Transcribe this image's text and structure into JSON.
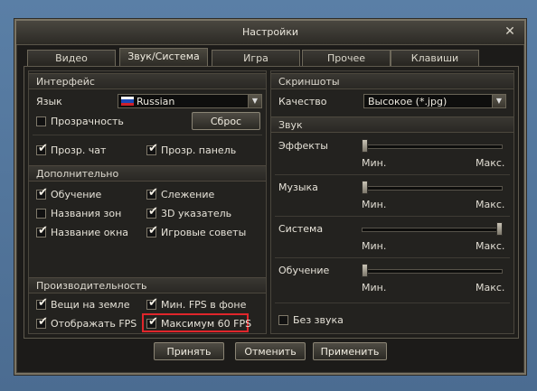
{
  "window": {
    "title": "Настройки",
    "close_glyph": "✕"
  },
  "tabs": [
    {
      "label": "Видео",
      "active": false
    },
    {
      "label": "Звук/Система",
      "active": true
    },
    {
      "label": "Игра",
      "active": false
    },
    {
      "label": "Прочее",
      "active": false
    },
    {
      "label": "Клавиши",
      "active": false
    }
  ],
  "left": {
    "interface": {
      "header": "Интерфейс",
      "language_label": "Язык",
      "language_value": "Russian",
      "transparency_label": "Прозрачность",
      "transparency_checked": false,
      "reset_button": "Сброс",
      "chat_label": "Прозр. чат",
      "chat_checked": true,
      "panel_label": "Прозр. панель",
      "panel_checked": true
    },
    "additional": {
      "header": "Дополнительно",
      "items": [
        {
          "label": "Обучение",
          "checked": true
        },
        {
          "label": "Слежение",
          "checked": true
        },
        {
          "label": "Названия зон",
          "checked": false
        },
        {
          "label": "3D указатель",
          "checked": true
        },
        {
          "label": "Название окна",
          "checked": true
        },
        {
          "label": "Игровые советы",
          "checked": true
        }
      ]
    },
    "performance": {
      "header": "Производительность",
      "items": [
        {
          "label": "Вещи на земле",
          "checked": true
        },
        {
          "label": "Мин. FPS в фоне",
          "checked": true
        },
        {
          "label": "Отображать FPS",
          "checked": true
        },
        {
          "label": "Максимум 60 FPS",
          "checked": true
        }
      ]
    }
  },
  "right": {
    "screenshots": {
      "header": "Скриншоты",
      "quality_label": "Качество",
      "quality_value": "Высокое (*.jpg)"
    },
    "sound": {
      "header": "Звук",
      "min_label": "Мин.",
      "max_label": "Макс.",
      "sliders": [
        {
          "label": "Эффекты",
          "level": 0.0
        },
        {
          "label": "Музыка",
          "level": 0.0
        },
        {
          "label": "Система",
          "level": 1.0
        },
        {
          "label": "Обучение",
          "level": 0.0
        }
      ],
      "mute_label": "Без звука",
      "mute_checked": false
    }
  },
  "footer": {
    "accept": "Принять",
    "cancel": "Отменить",
    "apply": "Применить"
  },
  "colors": {
    "highlight": "#e0262b",
    "accent": "#7a7465"
  }
}
